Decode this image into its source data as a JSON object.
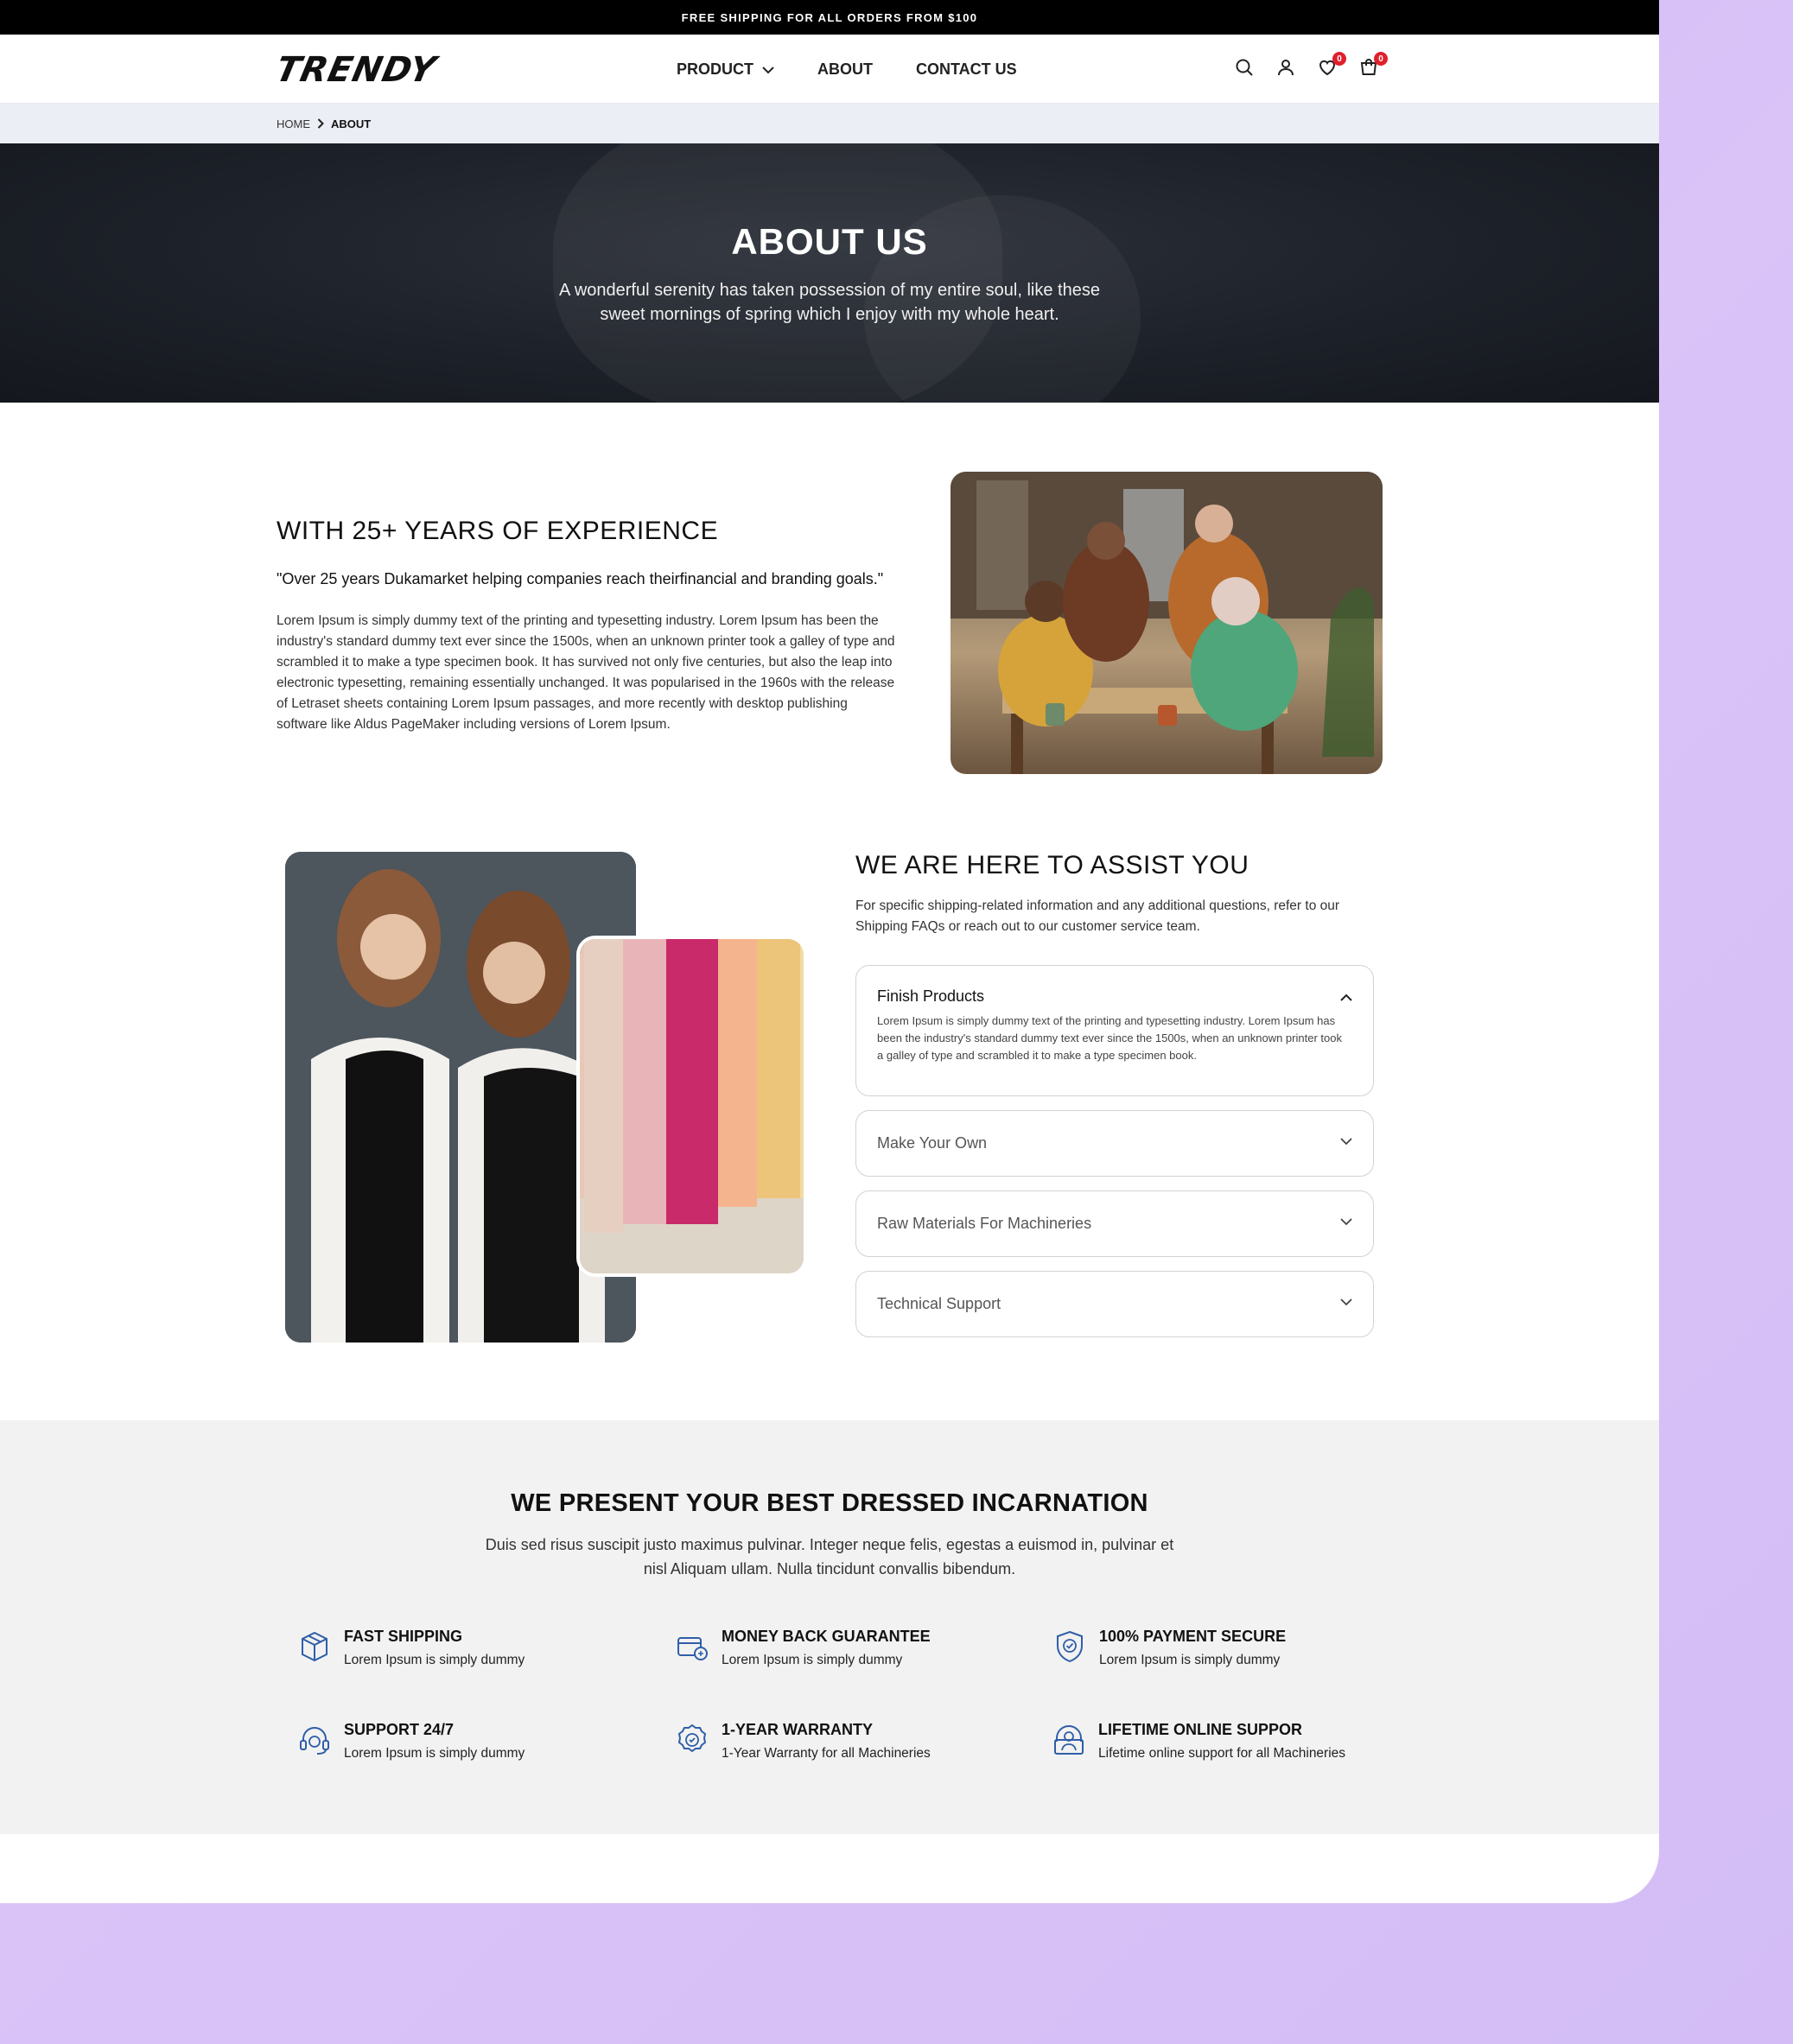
{
  "topbar": {
    "text": "FREE SHIPPING FOR ALL ORDERS FROM $100"
  },
  "header": {
    "logo": "TRENDY",
    "nav": [
      {
        "label": "PRODUCT",
        "has_dropdown": true
      },
      {
        "label": "ABOUT"
      },
      {
        "label": "CONTACT US"
      }
    ],
    "icons": [
      {
        "name": "search-icon"
      },
      {
        "name": "user-icon"
      },
      {
        "name": "heart-icon",
        "count": "0"
      },
      {
        "name": "cart-icon",
        "count": "0"
      }
    ]
  },
  "breadcrumb": {
    "home": "HOME",
    "current": "ABOUT"
  },
  "hero": {
    "title": "ABOUT US",
    "text": "A wonderful serenity has taken possession of my entire soul, like these sweet mornings of spring which I enjoy with my whole heart."
  },
  "experience": {
    "title": "WITH 25+ YEARS OF EXPERIENCE",
    "quote": "\"Over 25 years Dukamarket helping companies reach theirfinancial and branding goals.\"",
    "body": "Lorem Ipsum is simply dummy text of the printing and typesetting industry. Lorem Ipsum has been the industry's standard dummy text ever since the 1500s, when an unknown printer took a galley of type and scrambled it to make a type specimen book. It has survived not only five centuries, but also the leap into electronic typesetting, remaining essentially unchanged. It was popularised in the 1960s with the release of Letraset sheets containing Lorem Ipsum passages, and more recently with desktop publishing software like Aldus PageMaker including versions of Lorem Ipsum."
  },
  "assist": {
    "title": "WE ARE HERE TO ASSIST YOU",
    "text": "For specific shipping-related information and any additional questions, refer to our Shipping FAQs or reach out to our customer service team.",
    "faqs": [
      {
        "title": "Finish Products",
        "body": "Lorem Ipsum is simply dummy text of the printing and typesetting industry. Lorem Ipsum has been the industry's standard dummy text ever since the 1500s, when an unknown printer took a galley of type and scrambled it to make a type specimen book.",
        "open": true
      },
      {
        "title": "Make Your Own",
        "open": false
      },
      {
        "title": "Raw Materials For Machineries",
        "open": false
      },
      {
        "title": "Technical Support",
        "open": false
      }
    ]
  },
  "features": {
    "title": "WE PRESENT YOUR BEST DRESSED INCARNATION",
    "subtitle": "Duis sed risus suscipit justo maximus pulvinar. Integer neque felis, egestas a euismod in, pulvinar et nisl Aliquam ullam. Nulla tincidunt convallis bibendum.",
    "items": [
      {
        "title": "FAST SHIPPING",
        "desc": "Lorem Ipsum is simply dummy",
        "icon": "box-icon"
      },
      {
        "title": "MONEY BACK GUARANTEE",
        "desc": "Lorem Ipsum is simply dummy",
        "icon": "money-back-icon"
      },
      {
        "title": "100% PAYMENT SECURE",
        "desc": "Lorem Ipsum is simply dummy",
        "icon": "shield-check-icon"
      },
      {
        "title": "SUPPORT 24/7",
        "desc": "Lorem Ipsum is simply dummy",
        "icon": "headset-icon"
      },
      {
        "title": "1-YEAR WARRANTY",
        "desc": "1-Year Warranty for all Machineries",
        "icon": "warranty-badge-icon"
      },
      {
        "title": "LIFETIME ONLINE SUPPOR",
        "desc": "Lifetime online support for all Machineries",
        "icon": "online-support-icon"
      }
    ]
  },
  "colors": {
    "accent_blue": "#2f5ea8",
    "badge_red": "#e0202c",
    "page_bg": "#d4bdf6"
  }
}
